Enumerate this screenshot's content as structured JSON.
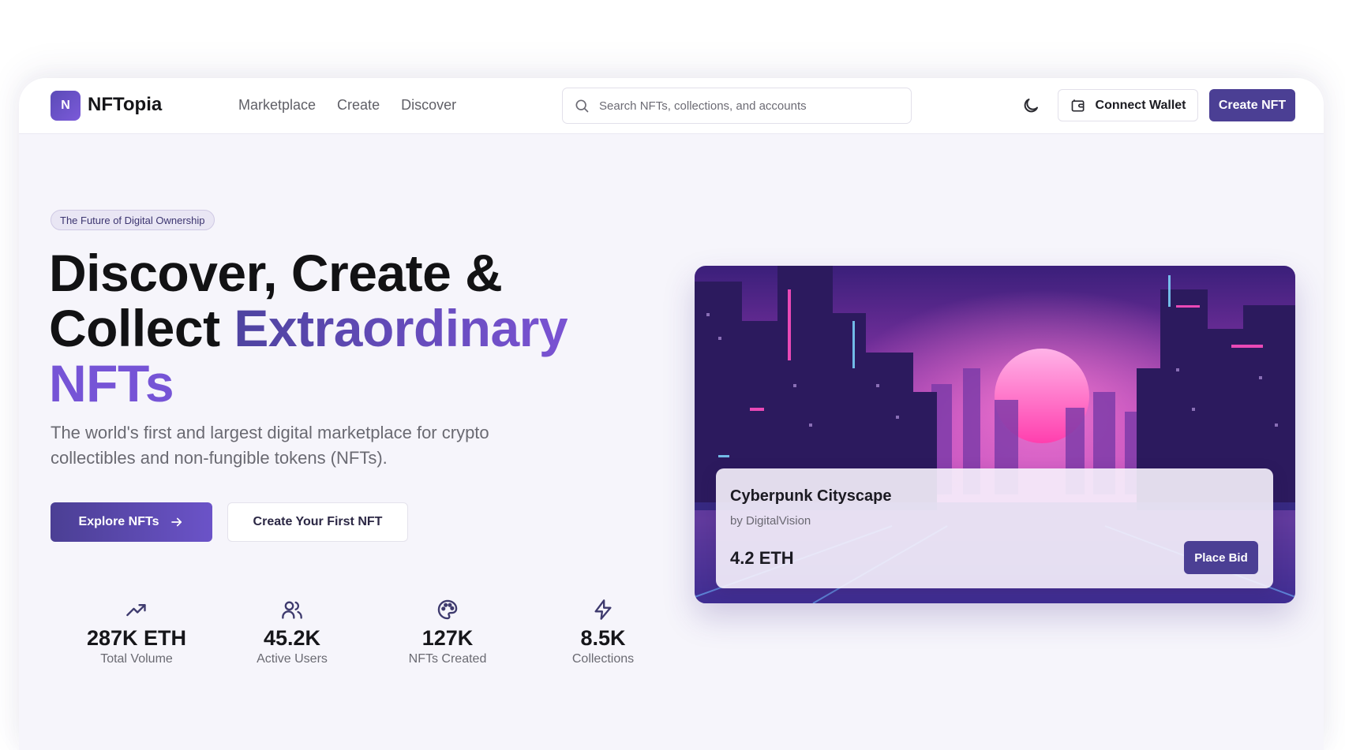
{
  "brand": {
    "logo_letter": "N",
    "name": "NFTopia"
  },
  "nav": {
    "links": [
      {
        "label": "Marketplace"
      },
      {
        "label": "Create"
      },
      {
        "label": "Discover"
      }
    ],
    "search_placeholder": "Search NFTs, collections, and accounts",
    "theme_toggle_icon": "moon-icon",
    "connect_wallet_label": "Connect Wallet",
    "create_nft_label": "Create NFT"
  },
  "hero": {
    "badge": "The Future of Digital Ownership",
    "headline_line1": "Discover, Create &",
    "headline_line2_plain": "Collect ",
    "headline_line2_accent": "Extraordinary",
    "headline_line3_accent": "NFTs",
    "subtitle": "The world's first and largest digital marketplace for crypto collectibles and non-fungible tokens (NFTs).",
    "primary_button": "Explore NFTs",
    "secondary_button": "Create Your First NFT"
  },
  "stats": [
    {
      "icon": "trending-up-icon",
      "value": "287K ETH",
      "label": "Total Volume"
    },
    {
      "icon": "users-icon",
      "value": "45.2K",
      "label": "Active Users"
    },
    {
      "icon": "palette-icon",
      "value": "127K",
      "label": "NFTs Created"
    },
    {
      "icon": "zap-icon",
      "value": "8.5K",
      "label": "Collections"
    }
  ],
  "featured_nft": {
    "title": "Cyberpunk Cityscape",
    "creator": "by DigitalVision",
    "price": "4.2 ETH",
    "bid_button": "Place Bid"
  },
  "colors": {
    "primary": "#4b3f94",
    "accent_purple": "#7654d6",
    "page_bg": "#f6f5fb",
    "text_dark": "#121214",
    "text_muted": "#6a6a72"
  }
}
